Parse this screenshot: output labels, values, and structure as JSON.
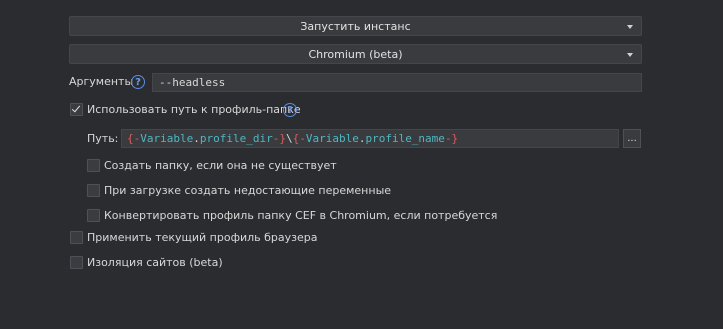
{
  "instance_dropdown": {
    "value": "Запустить инстанс"
  },
  "browser_dropdown": {
    "value": "Chromium (beta)"
  },
  "arguments": {
    "label": "Аргументы",
    "value": "--headless"
  },
  "use_profile_path": {
    "label": "Использовать путь к профиль-папке",
    "checked": true
  },
  "path": {
    "label": "Путь:",
    "tokens": {
      "open1": "{-",
      "var1": "Variable",
      "dot1": ".",
      "name1": "profile_dir",
      "close1": "-}",
      "sep": "\\",
      "open2": "{-",
      "var2": "Variable",
      "dot2": ".",
      "name2": "profile_name",
      "close2": "-}"
    },
    "browse_label": "..."
  },
  "options": {
    "create_folder": {
      "label": "Создать папку, если она не существует",
      "checked": false
    },
    "create_missing_vars": {
      "label": "При загрузке создать недостающие переменные",
      "checked": false
    },
    "convert_cef": {
      "label": "Конвертировать профиль папку CEF в Chromium, если потребуется",
      "checked": false
    },
    "apply_current_profile": {
      "label": "Применить текущий профиль браузера",
      "checked": false
    },
    "site_isolation": {
      "label": "Изоляция сайтов (beta)",
      "checked": false
    }
  },
  "help_glyph": "?"
}
